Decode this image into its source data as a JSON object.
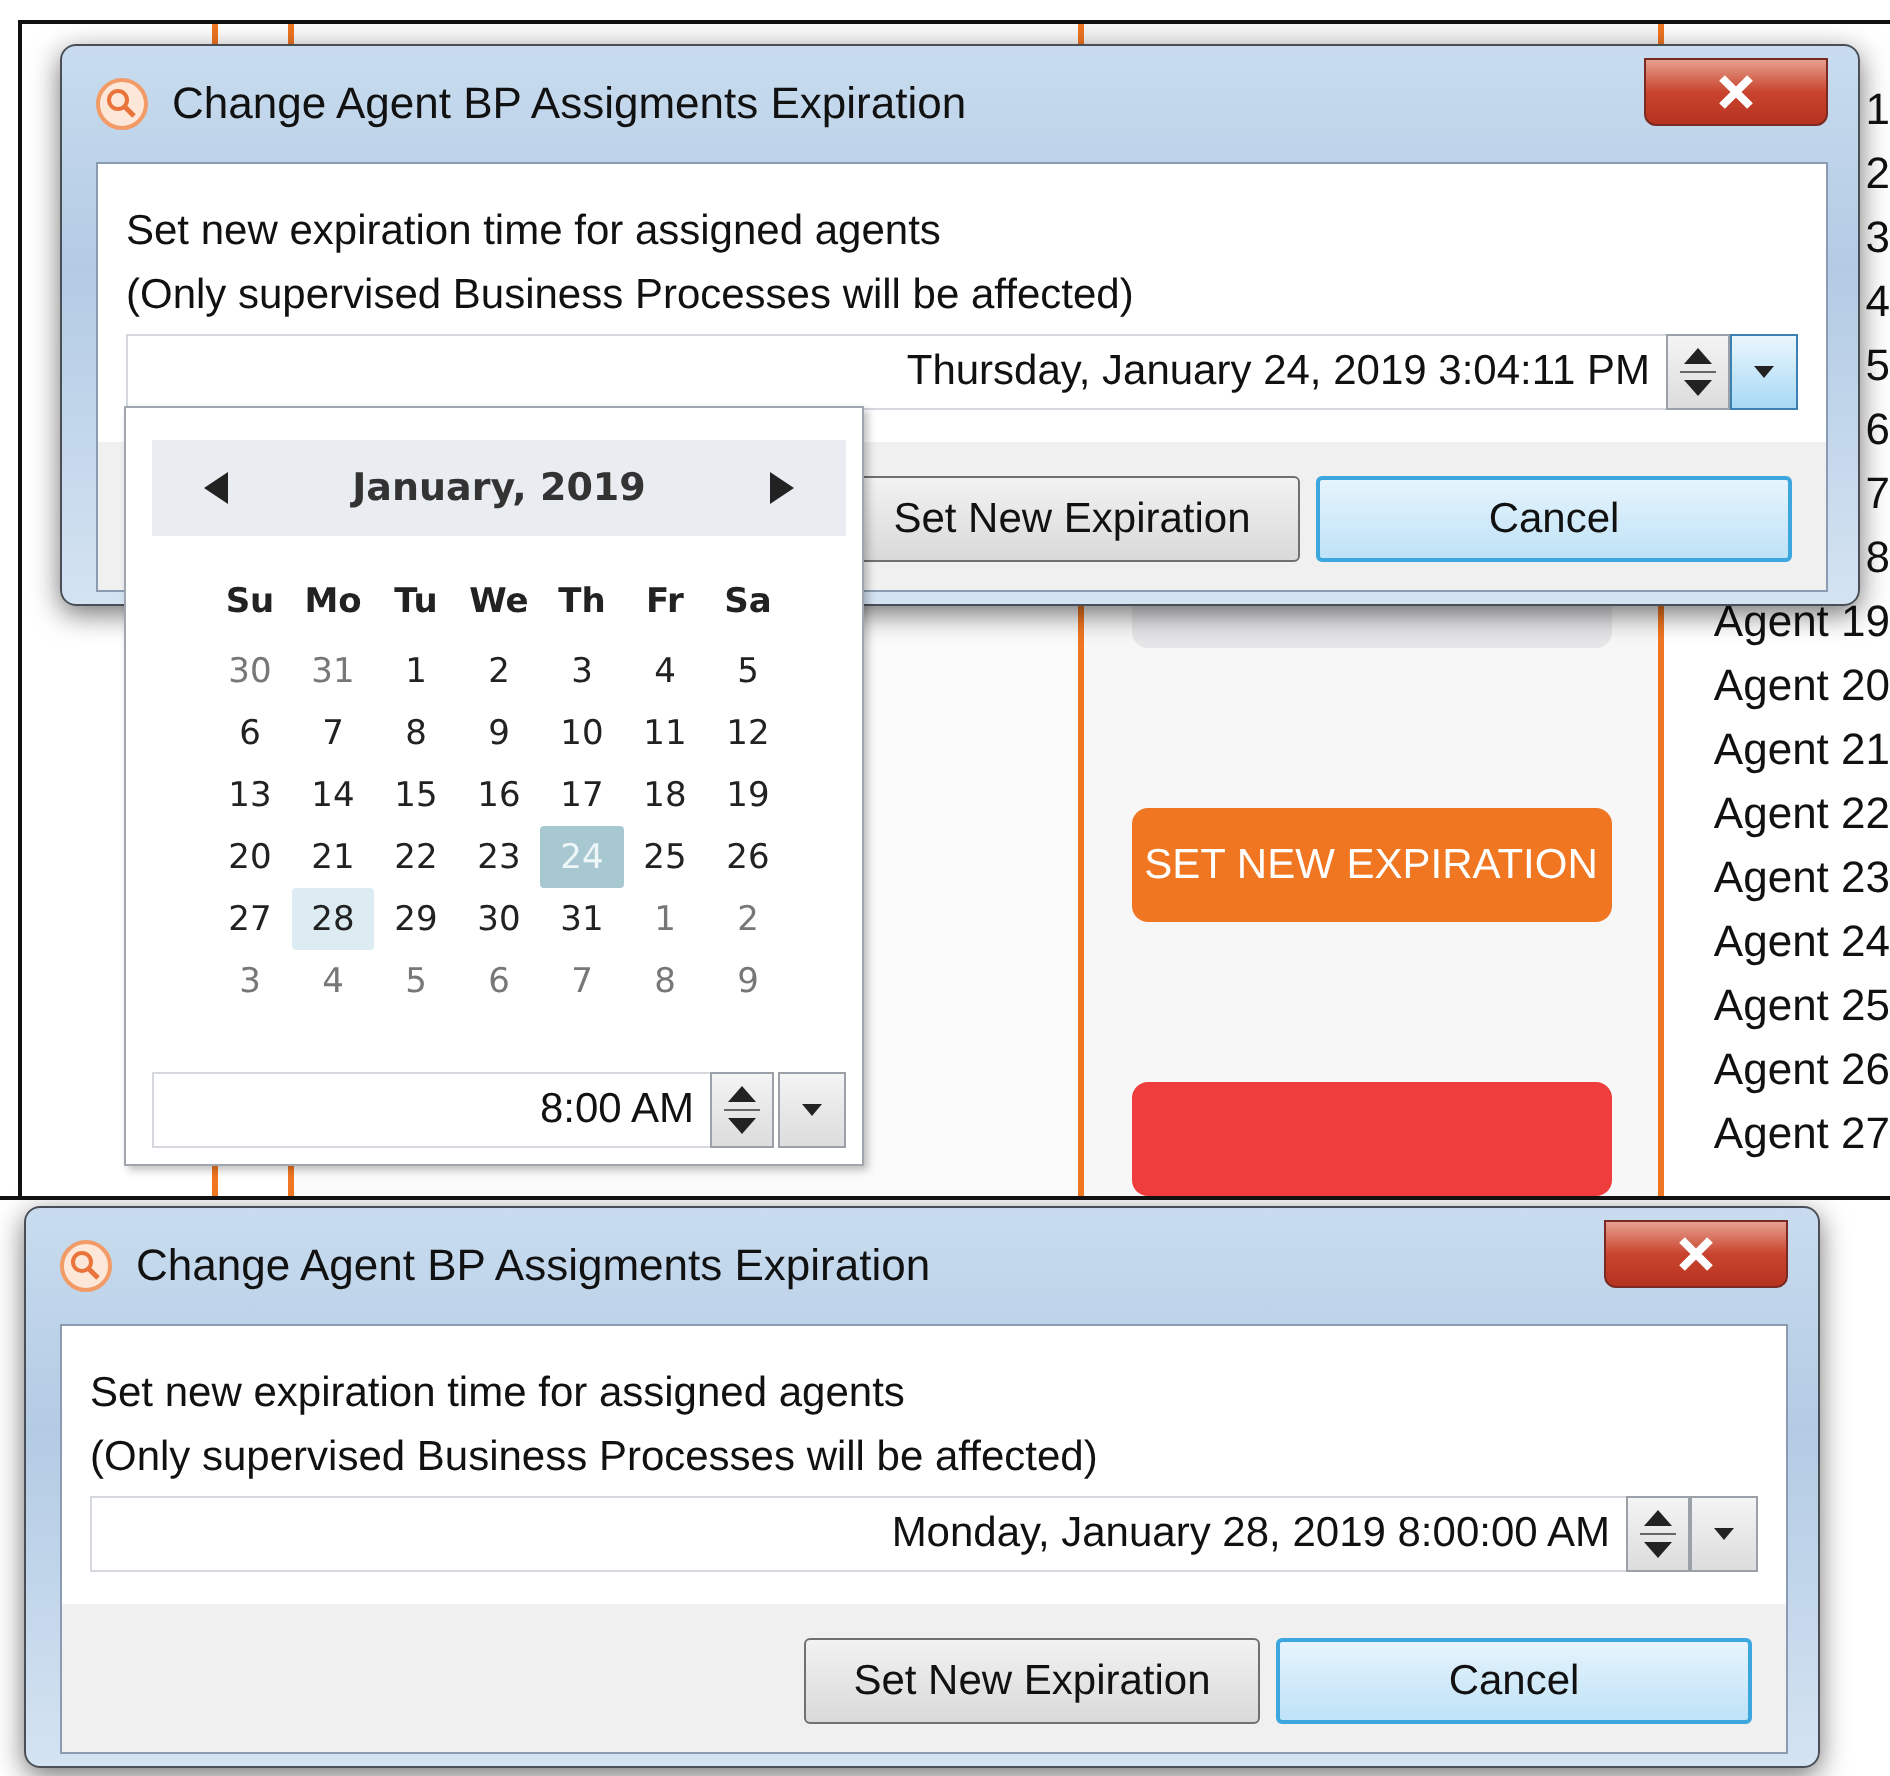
{
  "background_app": {
    "action_buttons": [
      {
        "kind": "neutral"
      },
      {
        "kind": "primary",
        "label": "SET NEW EXPIRATION"
      },
      {
        "kind": "danger"
      }
    ],
    "agents": [
      "1",
      "2",
      "3",
      "4",
      "5",
      "6",
      "7",
      "8",
      "Agent 19",
      "Agent 20",
      "Agent 21",
      "Agent 22",
      "Agent 23",
      "Agent 24",
      "Agent 25",
      "Agent 26",
      "Agent 27"
    ]
  },
  "dialogs": [
    {
      "title": "Change Agent BP Assigments Expiration",
      "message_lines": [
        "Set new expiration time for assigned agents",
        "(Only supervised Business Processes will be affected)"
      ],
      "datetime_value": "Thursday, January 24, 2019 3:04:11 PM",
      "dropdown_open": true,
      "buttons": [
        {
          "label": "Set New Expiration",
          "default": false
        },
        {
          "label": "Cancel",
          "default": true
        }
      ],
      "date_picker": {
        "month": "January, 2019",
        "weekdays": [
          "Su",
          "Mo",
          "Tu",
          "We",
          "Th",
          "Fr",
          "Sa"
        ],
        "weeks": [
          [
            {
              "day": "30",
              "other_month": true,
              "selected": false,
              "hovered": false
            },
            {
              "day": "31",
              "other_month": true,
              "selected": false,
              "hovered": false
            },
            {
              "day": "1",
              "other_month": false,
              "selected": false,
              "hovered": false
            },
            {
              "day": "2",
              "other_month": false,
              "selected": false,
              "hovered": false
            },
            {
              "day": "3",
              "other_month": false,
              "selected": false,
              "hovered": false
            },
            {
              "day": "4",
              "other_month": false,
              "selected": false,
              "hovered": false
            },
            {
              "day": "5",
              "other_month": false,
              "selected": false,
              "hovered": false
            }
          ],
          [
            {
              "day": "6",
              "other_month": false,
              "selected": false,
              "hovered": false
            },
            {
              "day": "7",
              "other_month": false,
              "selected": false,
              "hovered": false
            },
            {
              "day": "8",
              "other_month": false,
              "selected": false,
              "hovered": false
            },
            {
              "day": "9",
              "other_month": false,
              "selected": false,
              "hovered": false
            },
            {
              "day": "10",
              "other_month": false,
              "selected": false,
              "hovered": false
            },
            {
              "day": "11",
              "other_month": false,
              "selected": false,
              "hovered": false
            },
            {
              "day": "12",
              "other_month": false,
              "selected": false,
              "hovered": false
            }
          ],
          [
            {
              "day": "13",
              "other_month": false,
              "selected": false,
              "hovered": false
            },
            {
              "day": "14",
              "other_month": false,
              "selected": false,
              "hovered": false
            },
            {
              "day": "15",
              "other_month": false,
              "selected": false,
              "hovered": false
            },
            {
              "day": "16",
              "other_month": false,
              "selected": false,
              "hovered": false
            },
            {
              "day": "17",
              "other_month": false,
              "selected": false,
              "hovered": false
            },
            {
              "day": "18",
              "other_month": false,
              "selected": false,
              "hovered": false
            },
            {
              "day": "19",
              "other_month": false,
              "selected": false,
              "hovered": false
            }
          ],
          [
            {
              "day": "20",
              "other_month": false,
              "selected": false,
              "hovered": false
            },
            {
              "day": "21",
              "other_month": false,
              "selected": false,
              "hovered": false
            },
            {
              "day": "22",
              "other_month": false,
              "selected": false,
              "hovered": false
            },
            {
              "day": "23",
              "other_month": false,
              "selected": false,
              "hovered": false
            },
            {
              "day": "24",
              "other_month": false,
              "selected": true,
              "hovered": false
            },
            {
              "day": "25",
              "other_month": false,
              "selected": false,
              "hovered": false
            },
            {
              "day": "26",
              "other_month": false,
              "selected": false,
              "hovered": false
            }
          ],
          [
            {
              "day": "27",
              "other_month": false,
              "selected": false,
              "hovered": false
            },
            {
              "day": "28",
              "other_month": false,
              "selected": false,
              "hovered": true
            },
            {
              "day": "29",
              "other_month": false,
              "selected": false,
              "hovered": false
            },
            {
              "day": "30",
              "other_month": false,
              "selected": false,
              "hovered": false
            },
            {
              "day": "31",
              "other_month": false,
              "selected": false,
              "hovered": false
            },
            {
              "day": "1",
              "other_month": true,
              "selected": false,
              "hovered": false
            },
            {
              "day": "2",
              "other_month": true,
              "selected": false,
              "hovered": false
            }
          ],
          [
            {
              "day": "3",
              "other_month": true,
              "selected": false,
              "hovered": false
            },
            {
              "day": "4",
              "other_month": true,
              "selected": false,
              "hovered": false
            },
            {
              "day": "5",
              "other_month": true,
              "selected": false,
              "hovered": false
            },
            {
              "day": "6",
              "other_month": true,
              "selected": false,
              "hovered": false
            },
            {
              "day": "7",
              "other_month": true,
              "selected": false,
              "hovered": false
            },
            {
              "day": "8",
              "other_month": true,
              "selected": false,
              "hovered": false
            },
            {
              "day": "9",
              "other_month": true,
              "selected": false,
              "hovered": false
            }
          ]
        ],
        "time_value": "8:00 AM"
      }
    },
    {
      "title": "Change Agent BP Assigments Expiration",
      "message_lines": [
        "Set new expiration time for assigned agents",
        "(Only supervised Business Processes will be affected)"
      ],
      "datetime_value": "Monday, January 28, 2019 8:00:00 AM",
      "dropdown_open": false,
      "buttons": [
        {
          "label": "Set New Expiration",
          "default": false
        },
        {
          "label": "Cancel",
          "default": true
        }
      ]
    }
  ]
}
